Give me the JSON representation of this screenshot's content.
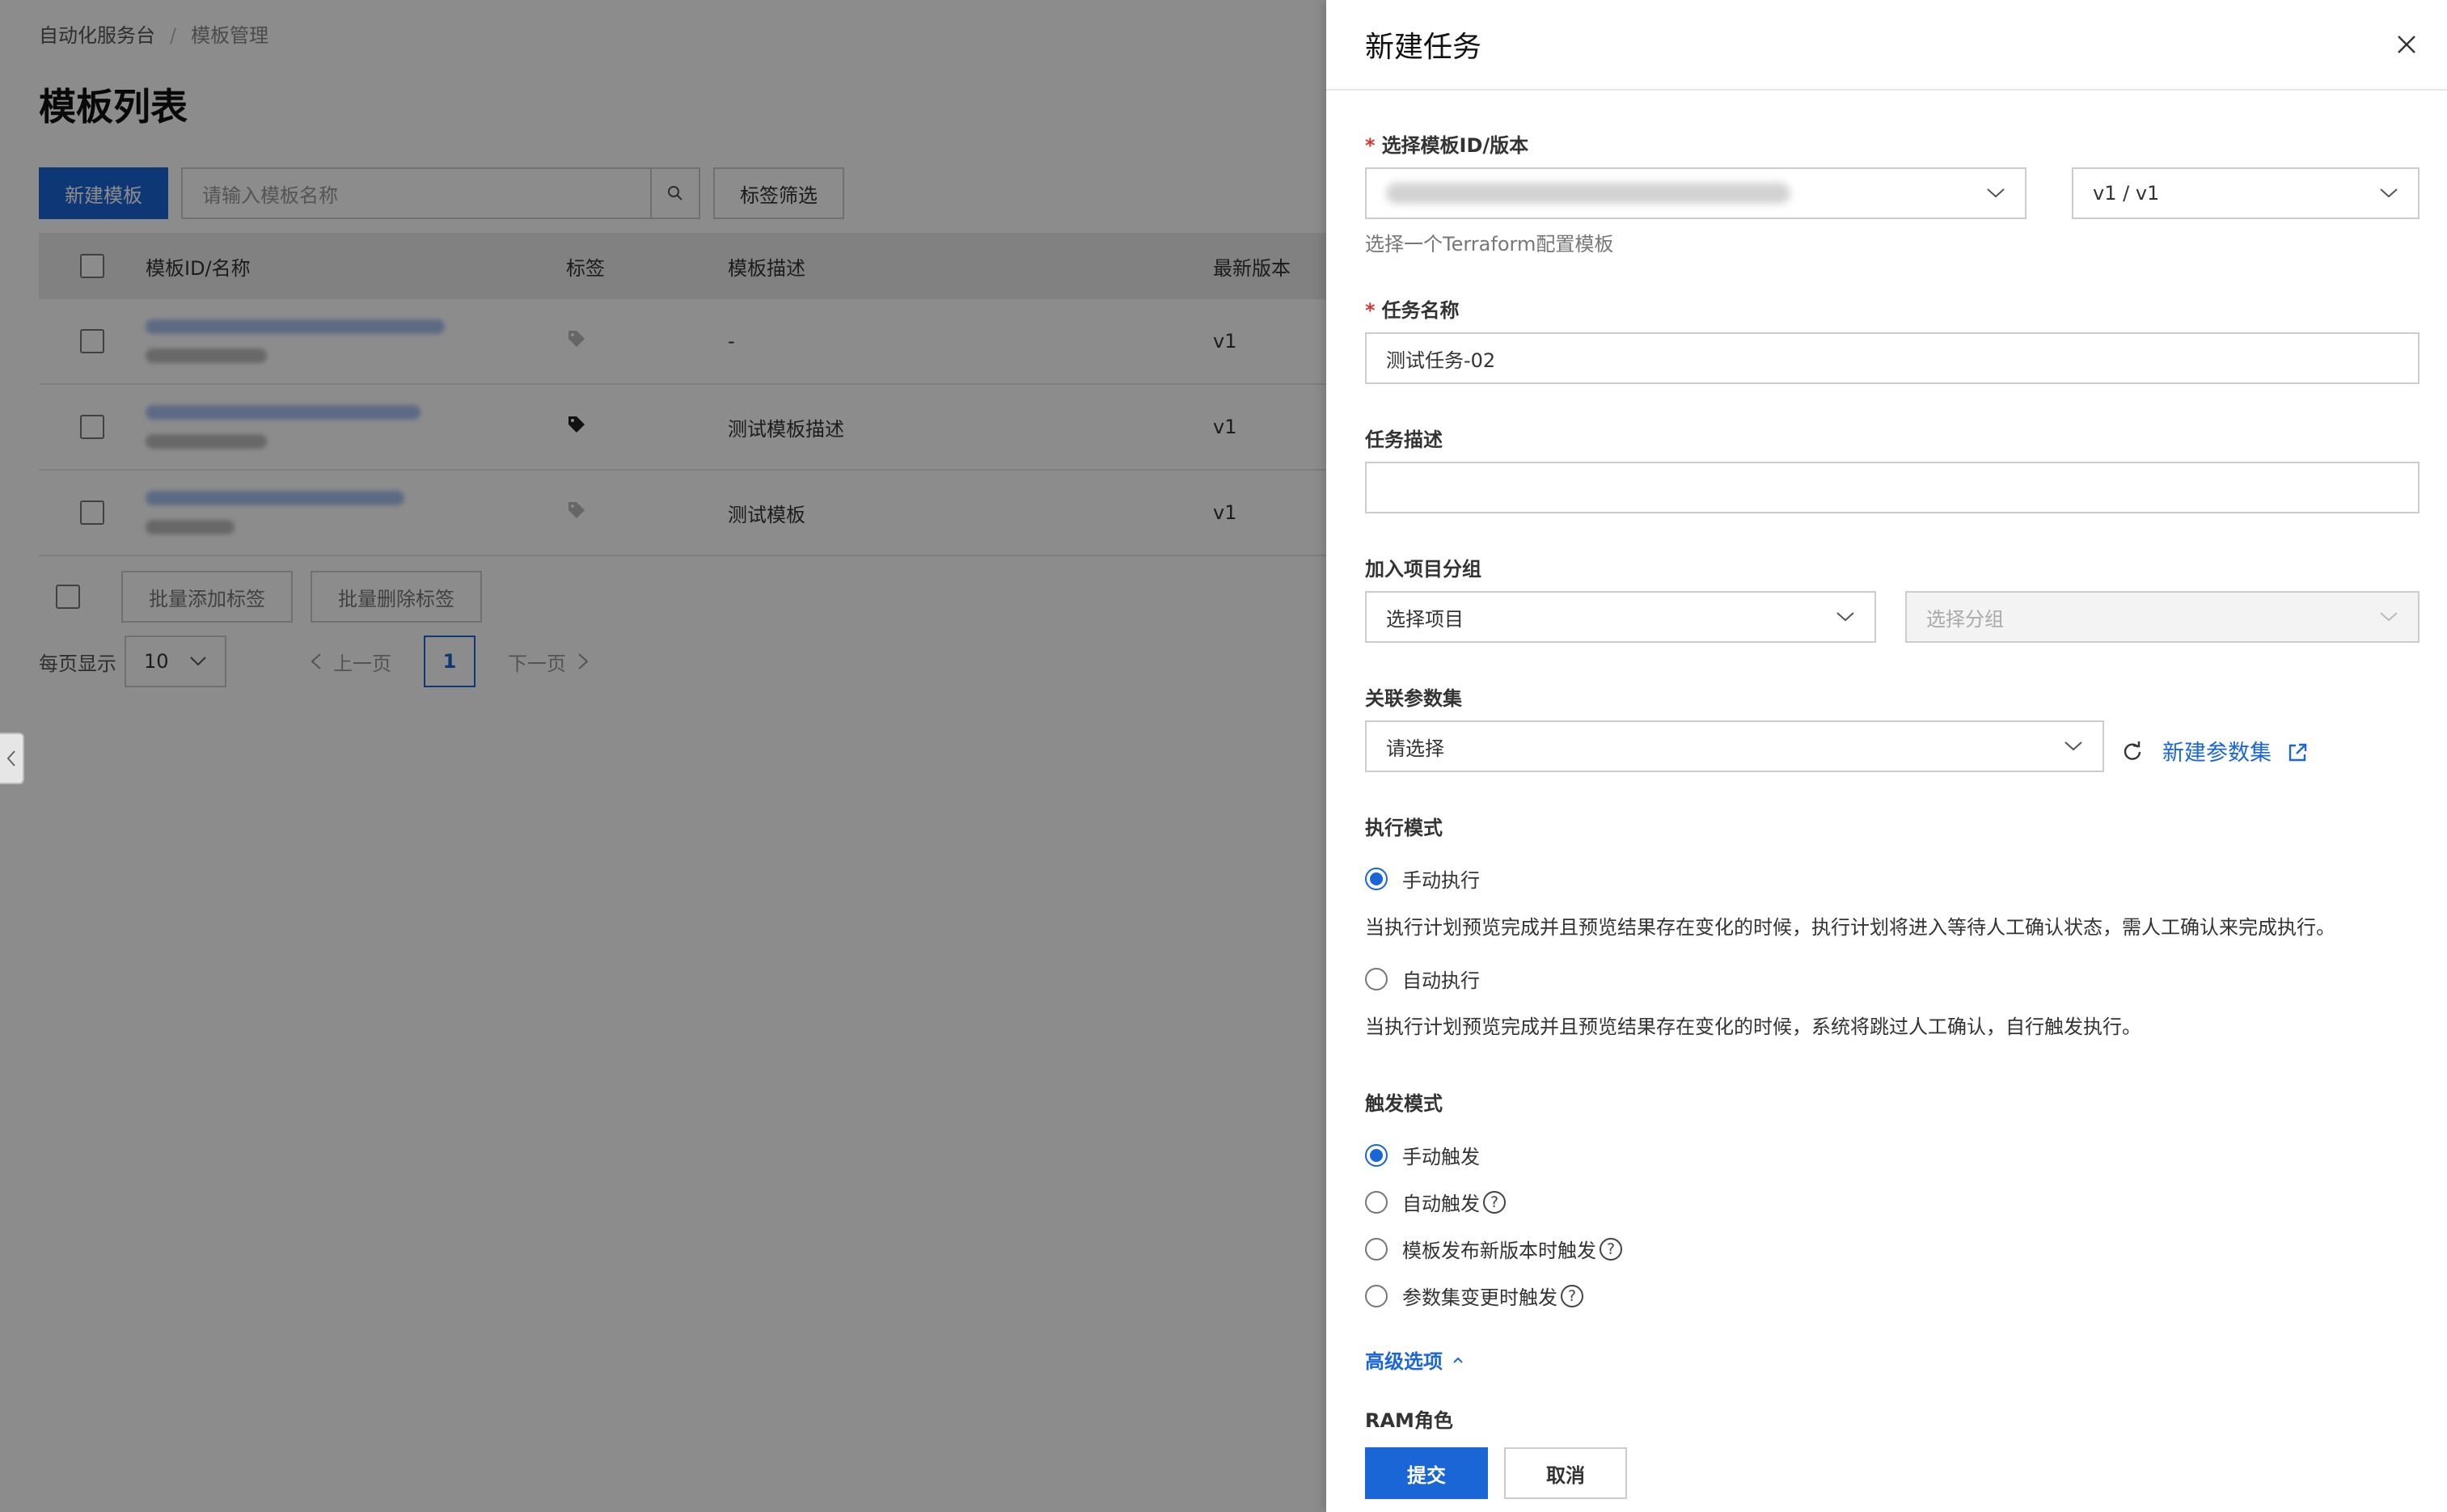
{
  "breadcrumb": {
    "root": "自动化服务台",
    "sep": "/",
    "current": "模板管理"
  },
  "page_title": "模板列表",
  "toolbar": {
    "new_label": "新建模板",
    "search_placeholder": "请输入模板名称",
    "tag_filter_label": "标签筛选"
  },
  "table": {
    "headers": {
      "id": "模板ID/名称",
      "tag": "标签",
      "desc": "模板描述",
      "version": "最新版本"
    },
    "rows": [
      {
        "desc": "-",
        "version": "v1"
      },
      {
        "desc": "测试模板描述",
        "version": "v1"
      },
      {
        "desc": "测试模板",
        "version": "v1"
      }
    ]
  },
  "batch": {
    "add_tag": "批量添加标签",
    "remove_tag": "批量删除标签"
  },
  "pager": {
    "per_page_label": "每页显示",
    "per_page_value": "10",
    "prev": "上一页",
    "page": "1",
    "next": "下一页"
  },
  "drawer": {
    "title": "新建任务",
    "template": {
      "label": "选择模板ID/版本",
      "version_value": "v1 / v1",
      "hint": "选择一个Terraform配置模板"
    },
    "task_name": {
      "label": "任务名称",
      "value": "测试任务-02"
    },
    "task_desc": {
      "label": "任务描述",
      "value": ""
    },
    "group": {
      "label": "加入项目分组",
      "project_placeholder": "选择项目",
      "group_placeholder": "选择分组"
    },
    "param_set": {
      "label": "关联参数集",
      "placeholder": "请选择",
      "new_link": "新建参数集"
    },
    "exec_mode": {
      "label": "执行模式",
      "manual": "手动执行",
      "manual_desc": "当执行计划预览完成并且预览结果存在变化的时候，执行计划将进入等待人工确认状态，需人工确认来完成执行。",
      "auto": "自动执行",
      "auto_desc": "当执行计划预览完成并且预览结果存在变化的时候，系统将跳过人工确认，自行触发执行。"
    },
    "trigger_mode": {
      "label": "触发模式",
      "options": [
        "手动触发",
        "自动触发",
        "模板发布新版本时触发",
        "参数集变更时触发"
      ]
    },
    "advanced": "高级选项",
    "ram_role": "RAM角色",
    "submit": "提交",
    "cancel": "取消"
  },
  "colors": {
    "primary": "#1a66d6",
    "required": "#e0332e"
  }
}
